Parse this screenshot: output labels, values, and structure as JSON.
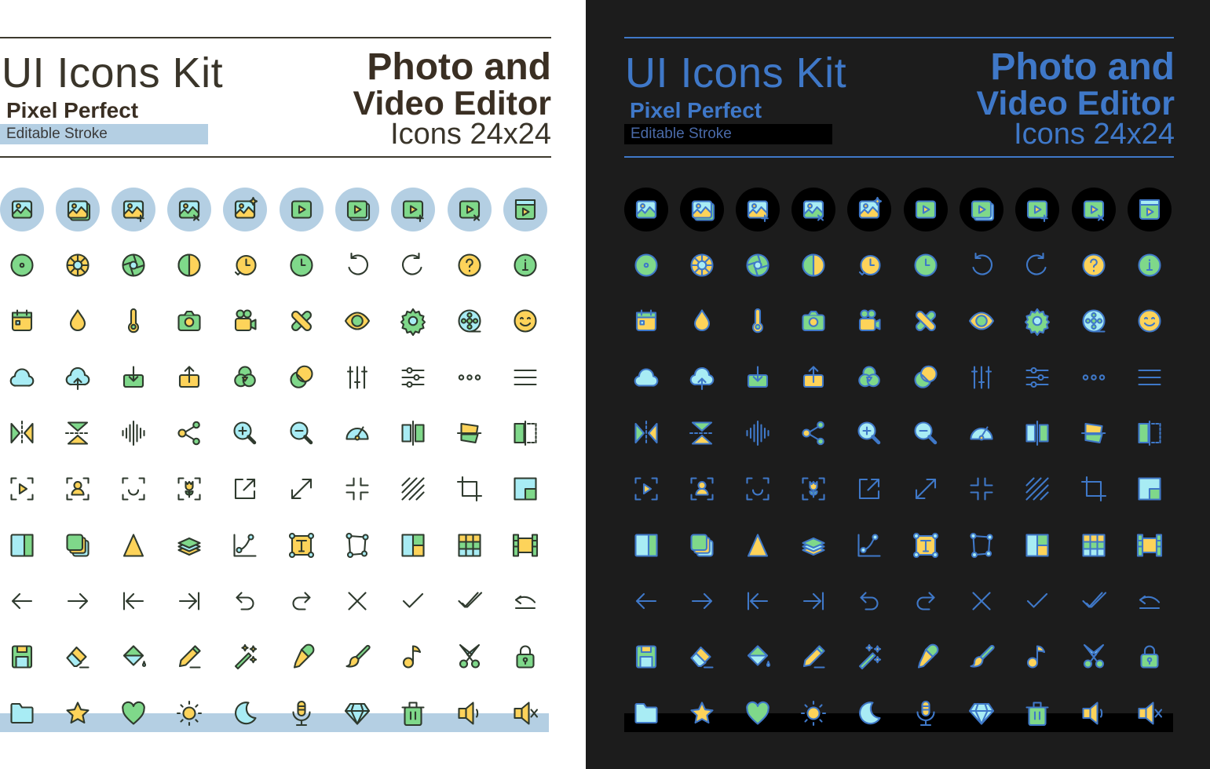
{
  "light_panel": {
    "title": "UI Icons Kit",
    "subtitle": "Pixel Perfect",
    "tag": "Editable Stroke",
    "headline_line1": "Photo and",
    "headline_line2": "Video Editor",
    "headline_line3": "Icons 24x24",
    "colors": {
      "background": "#ffffff",
      "text": "#3a2f23",
      "stroke": "#2f3a2e",
      "bubble": "#b4cfe3",
      "highlight_bar": "#b4cfe3"
    }
  },
  "dark_panel": {
    "title": "UI Icons Kit",
    "subtitle": "Pixel Perfect",
    "tag": "Editable Stroke",
    "headline_line1": "Photo and",
    "headline_line2": "Video Editor",
    "headline_line3": "Icons 24x24",
    "colors": {
      "background": "#1c1c1c",
      "text": "#3f78c8",
      "stroke": "#3f78c8",
      "bubble": "#000000",
      "highlight_bar": "#000000"
    }
  },
  "palette": {
    "green": "#7fd88a",
    "yellow": "#fdd35a",
    "cyan": "#a8ecf4"
  },
  "icon_rows": [
    [
      "image-icon",
      "images-stack-icon",
      "image-add-icon",
      "image-remove-icon",
      "image-enhance-icon",
      "video-play-icon",
      "videos-stack-icon",
      "video-add-icon",
      "video-remove-icon",
      "clapperboard-icon"
    ],
    [
      "record-circle-icon",
      "color-wheel-icon",
      "aperture-icon",
      "contrast-icon",
      "history-clock-icon",
      "clock-icon",
      "rotate-left-icon",
      "rotate-right-icon",
      "help-icon",
      "info-icon"
    ],
    [
      "calendar-icon",
      "drop-icon",
      "temperature-icon",
      "camera-icon",
      "video-camera-icon",
      "bandage-icon",
      "eye-icon",
      "gear-icon",
      "film-reel-icon",
      "smile-icon"
    ],
    [
      "cloud-icon",
      "cloud-upload-icon",
      "download-icon",
      "upload-icon",
      "color-channels-icon",
      "blend-icon",
      "equalizer-icon",
      "sliders-icon",
      "more-dots-icon",
      "menu-icon"
    ],
    [
      "flip-horizontal-icon",
      "flip-vertical-icon",
      "sound-wave-icon",
      "share-icon",
      "zoom-in-icon",
      "zoom-out-icon",
      "speedometer-icon",
      "align-center-icon",
      "straighten-icon",
      "split-view-icon"
    ],
    [
      "focus-video-icon",
      "focus-person-icon",
      "focus-face-icon",
      "focus-flower-icon",
      "external-link-icon",
      "expand-icon",
      "collapse-icon",
      "pattern-icon",
      "crop-icon",
      "picture-in-picture-icon"
    ],
    [
      "panel-split-icon",
      "copy-layers-icon",
      "triangle-icon",
      "layers-icon",
      "curve-icon",
      "text-box-icon",
      "polygon-path-icon",
      "layout-icon",
      "grid-icon",
      "film-strip-icon"
    ],
    [
      "arrow-left-icon",
      "arrow-right-icon",
      "arrow-left-bar-icon",
      "arrow-right-bar-icon",
      "undo-icon",
      "redo-icon",
      "close-icon",
      "check-icon",
      "double-check-icon",
      "revert-icon"
    ],
    [
      "save-icon",
      "eraser-icon",
      "fill-bucket-icon",
      "pencil-icon",
      "magic-wand-icon",
      "eyedropper-icon",
      "brush-icon",
      "music-note-icon",
      "scissors-icon",
      "lock-icon"
    ],
    [
      "folder-icon",
      "star-icon",
      "heart-icon",
      "sun-icon",
      "moon-icon",
      "microphone-icon",
      "diamond-icon",
      "trash-icon",
      "volume-icon",
      "mute-icon"
    ]
  ]
}
